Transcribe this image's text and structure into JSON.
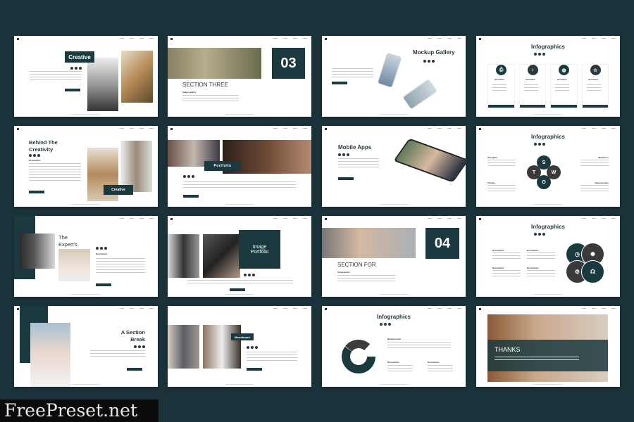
{
  "accent_color": "#1b3a40",
  "background_color": "#1b343b",
  "slides": {
    "creative": {
      "label": "Creative"
    },
    "section_three": {
      "number": "03",
      "title": "SECTION THREE",
      "subtitle": "Image gallery"
    },
    "mockup": {
      "title": "Mockup Gallery"
    },
    "infographics1": {
      "title": "Infographics",
      "cards": [
        "Description",
        "Description",
        "Description",
        "Description"
      ],
      "icons": [
        "printer-icon",
        "bell-icon",
        "globe-icon",
        "star-icon"
      ]
    },
    "behind": {
      "title1": "Behind The",
      "title2": "Creativity",
      "subtitle": "Description",
      "label": "Creative"
    },
    "portfolio": {
      "label": "Portfolio"
    },
    "mobile": {
      "title": "Mobile Apps"
    },
    "swot": {
      "title": "Infographics",
      "letters": [
        "S",
        "T",
        "W",
        "O"
      ],
      "labels": [
        "Strengths",
        "Weakness",
        "Threats",
        "Opportunities"
      ]
    },
    "expert": {
      "title1": "The",
      "title2": "Expert's",
      "subtitle": "Description"
    },
    "image_portfolio": {
      "title1": "Image",
      "title2": "Portfolio"
    },
    "section_four": {
      "number": "04",
      "title": "SECTION FOR",
      "subtitle": "Infographics"
    },
    "infographics3": {
      "title": "Infographics",
      "labels": [
        "Description",
        "Description",
        "Description",
        "Description"
      ]
    },
    "section_break": {
      "title1": "A Section",
      "title2": "Break"
    },
    "moodboard": {
      "label": "Moodboard"
    },
    "donut": {
      "title": "Infographics",
      "labels": [
        "Backgrounds",
        "Description",
        "Description"
      ],
      "segments": [
        0.12,
        0.28,
        0.6
      ]
    },
    "thanks": {
      "title": "THANKS"
    }
  },
  "watermark": "FreePreset.net"
}
